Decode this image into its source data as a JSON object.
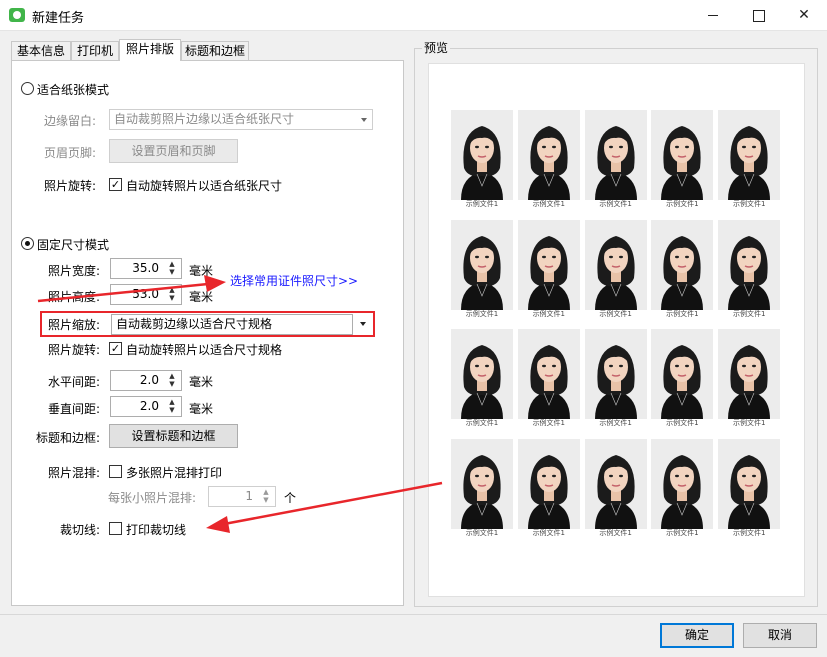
{
  "window": {
    "title": "新建任务"
  },
  "tabs": [
    {
      "label": "基本信息"
    },
    {
      "label": "打印机"
    },
    {
      "label": "照片排版"
    },
    {
      "label": "标题和边框"
    }
  ],
  "fit_paper_mode": {
    "label": "适合纸张模式",
    "selected": false,
    "margin_label": "边缘留白:",
    "margin_value": "自动裁剪照片边缘以适合纸张尺寸",
    "header_footer_label": "页眉页脚:",
    "header_footer_button": "设置页眉和页脚",
    "rotate_label": "照片旋转:",
    "rotate_checkbox_label": "自动旋转照片以适合纸张尺寸",
    "rotate_checked": true
  },
  "fixed_size_mode": {
    "label": "固定尺寸模式",
    "selected": true,
    "width_label": "照片宽度:",
    "width_value": "35.0",
    "height_label": "照片高度:",
    "height_value": "53.0",
    "unit": "毫米",
    "common_size_link": "选择常用证件照尺寸>>",
    "scale_label": "照片缩放:",
    "scale_value": "自动裁剪边缘以适合尺寸规格",
    "rotate_label": "照片旋转:",
    "rotate_checkbox_label": "自动旋转照片以适合尺寸规格",
    "rotate_checked": true,
    "hspacing_label": "水平间距:",
    "hspacing_value": "2.0",
    "vspacing_label": "垂直间距:",
    "vspacing_value": "2.0",
    "title_border_label": "标题和边框:",
    "title_border_button": "设置标题和边框",
    "mix_label": "照片混排:",
    "mix_checkbox_label": "多张照片混排打印",
    "mix_checked": false,
    "mix_count_label": "每张小照片混排:",
    "mix_count_value": "1",
    "mix_count_unit": "个",
    "cut_label": "裁切线:",
    "cut_checkbox_label": "打印裁切线",
    "cut_checked": false
  },
  "preview": {
    "title": "预览",
    "caption": "示例文件1",
    "rows": 4,
    "cols": 5
  },
  "buttons": {
    "ok": "确定",
    "cancel": "取消"
  },
  "colors": {
    "annotation_red": "#e8262b",
    "link_blue": "#1a1aff",
    "accent": "#0078d7"
  },
  "icons": {
    "check": "✓",
    "close": "✕",
    "spin_up": "▲",
    "spin_down": "▼"
  }
}
